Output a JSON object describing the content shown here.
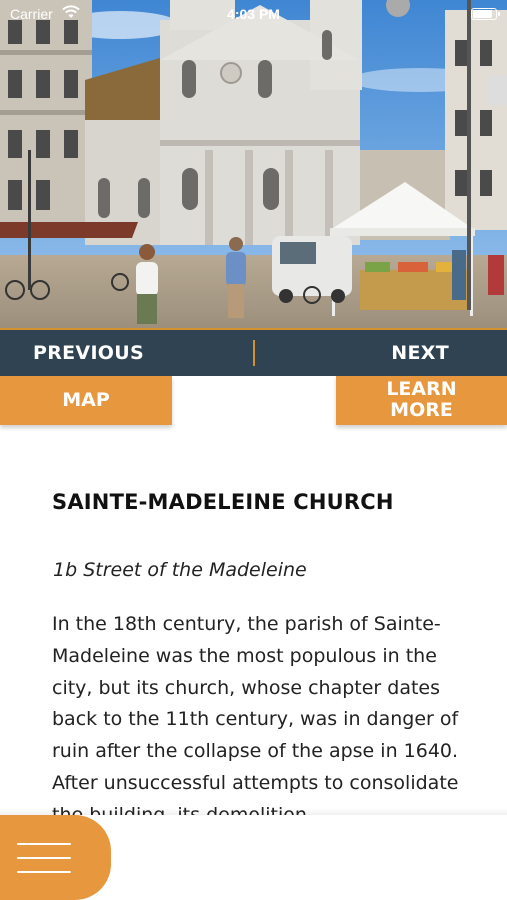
{
  "status_bar": {
    "carrier": "Carrier",
    "time": "4:03 PM"
  },
  "hero": {
    "image": "photo of a cathedral square with a market tent",
    "icon": "hero-photo"
  },
  "nav": {
    "previous_label": "PREVIOUS",
    "next_label": "NEXT"
  },
  "buttons": {
    "map_label": "MAP",
    "learn_more_line1": "LEARN",
    "learn_more_line2": "MORE"
  },
  "article": {
    "title": "SAINTE-MADELEINE CHURCH",
    "address": "1b Street of the Madeleine",
    "body": "In the 18th century, the parish of Sainte-Madeleine was the most populous in the city, but its church, whose chapter dates back to the 11th century, was in danger of ruin after the collapse of the apse in 1640. After unsuccessful attempts to consolidate the building, its demolition"
  },
  "menu": {
    "icon": "hamburger-menu-icon"
  },
  "colors": {
    "accent": "#e7983e",
    "navbar": "#2f4352",
    "divider": "#d4922f"
  }
}
